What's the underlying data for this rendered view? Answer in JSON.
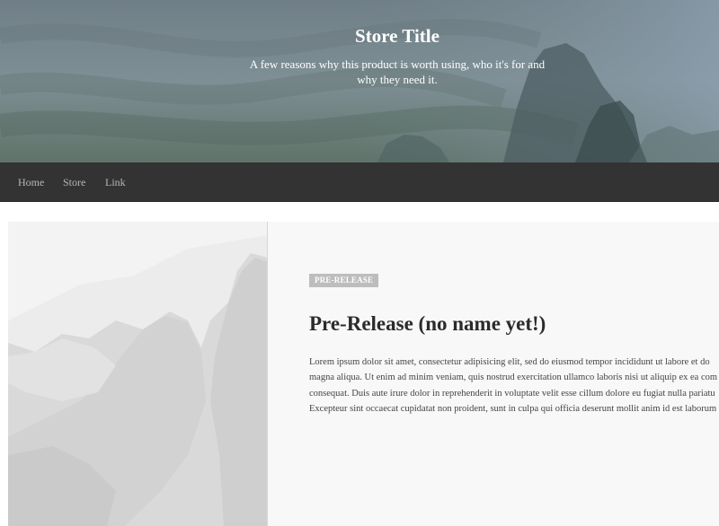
{
  "header": {
    "title": "Store Title",
    "subtitle": "A few reasons why this product is worth using, who it's for and why they need it."
  },
  "nav": {
    "items": [
      {
        "label": "Home"
      },
      {
        "label": "Store"
      },
      {
        "label": "Link"
      }
    ]
  },
  "product": {
    "badge": "PRE-RELEASE",
    "title": "Pre-Release (no name yet!)",
    "description_lines": [
      "Lorem ipsum dolor sit amet, consectetur adipisicing elit, sed do eiusmod tempor incididunt ut labore et do",
      "magna aliqua. Ut enim ad minim veniam, quis nostrud exercitation ullamco laboris nisi ut aliquip ex ea com",
      "consequat. Duis aute irure dolor in reprehenderit in voluptate velit esse cillum dolore eu fugiat nulla pariatu",
      "Excepteur sint occaecat cupidatat non proident, sunt in culpa qui officia deserunt mollit anim id est laborum"
    ]
  },
  "colors": {
    "navbar": "#333333",
    "nav_text": "#b7b7b7",
    "badge": "#bdbdbd",
    "product_bg": "#f8f8f8"
  }
}
